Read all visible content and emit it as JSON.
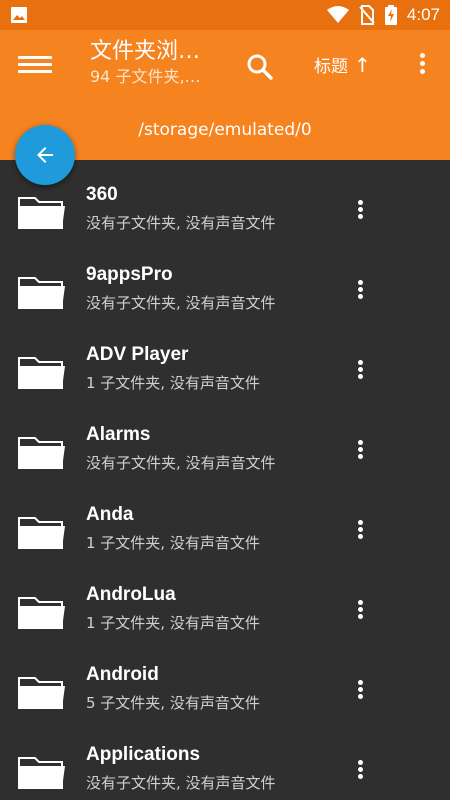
{
  "status_bar": {
    "time": "4:07",
    "icons": [
      "image-icon",
      "wifi-icon",
      "no-sim-icon",
      "battery-charging-icon"
    ]
  },
  "app_bar": {
    "title": "文件夹浏…",
    "subtitle": "94 子文件夹,…",
    "sort_label": "标题",
    "sort_arrow": "↑"
  },
  "path_bar": {
    "path": "/storage/emulated/0"
  },
  "folders": [
    {
      "name": "360",
      "desc": "没有子文件夹, 没有声音文件"
    },
    {
      "name": "9appsPro",
      "desc": "没有子文件夹, 没有声音文件"
    },
    {
      "name": "ADV Player",
      "desc": "1 子文件夹, 没有声音文件"
    },
    {
      "name": "Alarms",
      "desc": "没有子文件夹, 没有声音文件"
    },
    {
      "name": "Anda",
      "desc": "1 子文件夹, 没有声音文件"
    },
    {
      "name": "AndroLua",
      "desc": "1 子文件夹, 没有声音文件"
    },
    {
      "name": "Android",
      "desc": "5 子文件夹, 没有声音文件"
    },
    {
      "name": "Applications",
      "desc": "没有子文件夹, 没有声音文件"
    }
  ],
  "colors": {
    "accent": "#f5831f",
    "status_bar": "#e8700f",
    "fab": "#1f9bdc",
    "background": "#2f2f2f"
  }
}
